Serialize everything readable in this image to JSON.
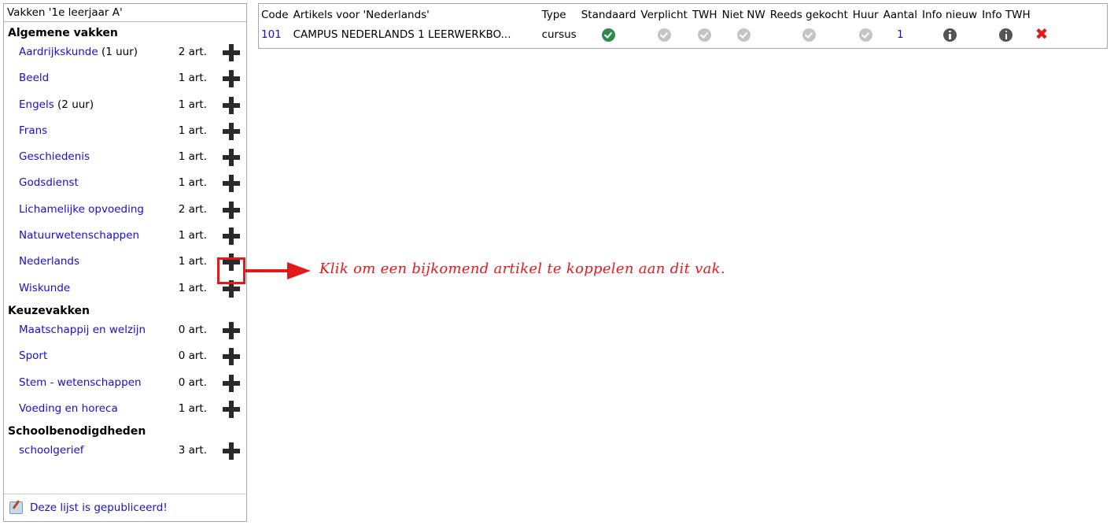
{
  "panel": {
    "title": "Vakken '1e leerjaar A'",
    "groups": [
      {
        "title": "Algemene vakken",
        "items": [
          {
            "name": "Aardrijkskunde",
            "hours": " (1 uur)",
            "count": "2 art."
          },
          {
            "name": "Beeld",
            "hours": "",
            "count": "1 art."
          },
          {
            "name": "Engels",
            "hours": " (2 uur)",
            "count": "1 art."
          },
          {
            "name": "Frans",
            "hours": "",
            "count": "1 art."
          },
          {
            "name": "Geschiedenis",
            "hours": "",
            "count": "1 art."
          },
          {
            "name": "Godsdienst",
            "hours": "",
            "count": "1 art."
          },
          {
            "name": "Lichamelijke opvoeding",
            "hours": "",
            "count": "2 art."
          },
          {
            "name": "Natuurwetenschappen",
            "hours": "",
            "count": "1 art."
          },
          {
            "name": "Nederlands",
            "hours": "",
            "count": "1 art."
          },
          {
            "name": "Wiskunde",
            "hours": "",
            "count": "1 art."
          }
        ]
      },
      {
        "title": "Keuzevakken",
        "items": [
          {
            "name": "Maatschappij en welzijn",
            "hours": "",
            "count": "0 art."
          },
          {
            "name": "Sport",
            "hours": "",
            "count": "0 art."
          },
          {
            "name": "Stem - wetenschappen",
            "hours": "",
            "count": "0 art."
          },
          {
            "name": "Voeding en horeca",
            "hours": "",
            "count": "1 art."
          }
        ]
      },
      {
        "title": "Schoolbenodigdheden",
        "items": [
          {
            "name": "schoolgerief",
            "hours": "",
            "count": "3 art."
          }
        ]
      }
    ],
    "footer_link": "Deze lijst is gepubliceerd!"
  },
  "table": {
    "headers": [
      "Code",
      "Artikels voor 'Nederlands'",
      "Type",
      "Standaard",
      "Verplicht",
      "TWH",
      "Niet NW",
      "Reeds gekocht",
      "Huur",
      "Aantal",
      "Info nieuw",
      "Info TWH"
    ],
    "row": {
      "code": "101",
      "article": "CAMPUS NEDERLANDS 1 LEERWERKBO...",
      "type": "cursus",
      "standaard": "check-green",
      "verplicht": "check-gray",
      "twh": "check-gray",
      "niet_nw": "check-gray",
      "reeds_gekocht": "check-gray",
      "huur": "check-gray",
      "aantal": "1",
      "info_nieuw": "info-icon",
      "info_twh": "info-icon",
      "delete": "✖"
    }
  },
  "callout": "Klik om een bijkomend artikel te koppelen aan dit vak.",
  "colors": {
    "link": "#1a0dcc",
    "accent_red": "#e11b1b",
    "check_green": "#2f8a4e"
  }
}
